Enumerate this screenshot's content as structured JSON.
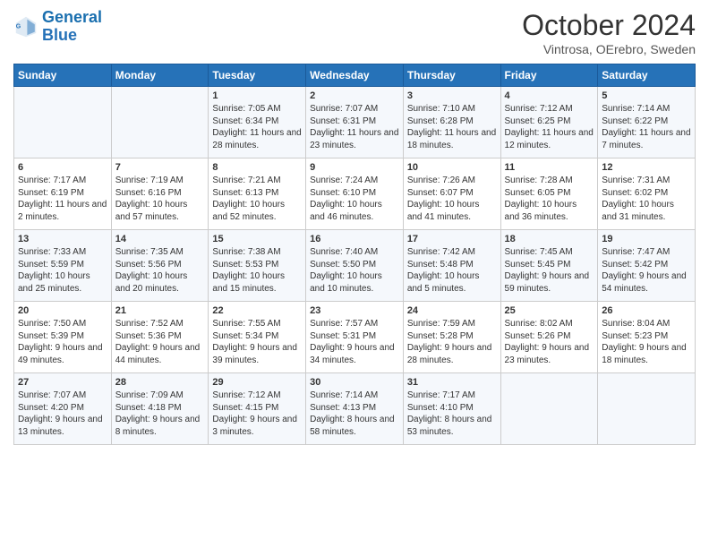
{
  "header": {
    "logo_line1": "General",
    "logo_line2": "Blue",
    "month": "October 2024",
    "location": "Vintrosa, OErebro, Sweden"
  },
  "days_of_week": [
    "Sunday",
    "Monday",
    "Tuesday",
    "Wednesday",
    "Thursday",
    "Friday",
    "Saturday"
  ],
  "weeks": [
    [
      {
        "day": "",
        "content": ""
      },
      {
        "day": "",
        "content": ""
      },
      {
        "day": "1",
        "content": "Sunrise: 7:05 AM\nSunset: 6:34 PM\nDaylight: 11 hours and 28 minutes."
      },
      {
        "day": "2",
        "content": "Sunrise: 7:07 AM\nSunset: 6:31 PM\nDaylight: 11 hours and 23 minutes."
      },
      {
        "day": "3",
        "content": "Sunrise: 7:10 AM\nSunset: 6:28 PM\nDaylight: 11 hours and 18 minutes."
      },
      {
        "day": "4",
        "content": "Sunrise: 7:12 AM\nSunset: 6:25 PM\nDaylight: 11 hours and 12 minutes."
      },
      {
        "day": "5",
        "content": "Sunrise: 7:14 AM\nSunset: 6:22 PM\nDaylight: 11 hours and 7 minutes."
      }
    ],
    [
      {
        "day": "6",
        "content": "Sunrise: 7:17 AM\nSunset: 6:19 PM\nDaylight: 11 hours and 2 minutes."
      },
      {
        "day": "7",
        "content": "Sunrise: 7:19 AM\nSunset: 6:16 PM\nDaylight: 10 hours and 57 minutes."
      },
      {
        "day": "8",
        "content": "Sunrise: 7:21 AM\nSunset: 6:13 PM\nDaylight: 10 hours and 52 minutes."
      },
      {
        "day": "9",
        "content": "Sunrise: 7:24 AM\nSunset: 6:10 PM\nDaylight: 10 hours and 46 minutes."
      },
      {
        "day": "10",
        "content": "Sunrise: 7:26 AM\nSunset: 6:07 PM\nDaylight: 10 hours and 41 minutes."
      },
      {
        "day": "11",
        "content": "Sunrise: 7:28 AM\nSunset: 6:05 PM\nDaylight: 10 hours and 36 minutes."
      },
      {
        "day": "12",
        "content": "Sunrise: 7:31 AM\nSunset: 6:02 PM\nDaylight: 10 hours and 31 minutes."
      }
    ],
    [
      {
        "day": "13",
        "content": "Sunrise: 7:33 AM\nSunset: 5:59 PM\nDaylight: 10 hours and 25 minutes."
      },
      {
        "day": "14",
        "content": "Sunrise: 7:35 AM\nSunset: 5:56 PM\nDaylight: 10 hours and 20 minutes."
      },
      {
        "day": "15",
        "content": "Sunrise: 7:38 AM\nSunset: 5:53 PM\nDaylight: 10 hours and 15 minutes."
      },
      {
        "day": "16",
        "content": "Sunrise: 7:40 AM\nSunset: 5:50 PM\nDaylight: 10 hours and 10 minutes."
      },
      {
        "day": "17",
        "content": "Sunrise: 7:42 AM\nSunset: 5:48 PM\nDaylight: 10 hours and 5 minutes."
      },
      {
        "day": "18",
        "content": "Sunrise: 7:45 AM\nSunset: 5:45 PM\nDaylight: 9 hours and 59 minutes."
      },
      {
        "day": "19",
        "content": "Sunrise: 7:47 AM\nSunset: 5:42 PM\nDaylight: 9 hours and 54 minutes."
      }
    ],
    [
      {
        "day": "20",
        "content": "Sunrise: 7:50 AM\nSunset: 5:39 PM\nDaylight: 9 hours and 49 minutes."
      },
      {
        "day": "21",
        "content": "Sunrise: 7:52 AM\nSunset: 5:36 PM\nDaylight: 9 hours and 44 minutes."
      },
      {
        "day": "22",
        "content": "Sunrise: 7:55 AM\nSunset: 5:34 PM\nDaylight: 9 hours and 39 minutes."
      },
      {
        "day": "23",
        "content": "Sunrise: 7:57 AM\nSunset: 5:31 PM\nDaylight: 9 hours and 34 minutes."
      },
      {
        "day": "24",
        "content": "Sunrise: 7:59 AM\nSunset: 5:28 PM\nDaylight: 9 hours and 28 minutes."
      },
      {
        "day": "25",
        "content": "Sunrise: 8:02 AM\nSunset: 5:26 PM\nDaylight: 9 hours and 23 minutes."
      },
      {
        "day": "26",
        "content": "Sunrise: 8:04 AM\nSunset: 5:23 PM\nDaylight: 9 hours and 18 minutes."
      }
    ],
    [
      {
        "day": "27",
        "content": "Sunrise: 7:07 AM\nSunset: 4:20 PM\nDaylight: 9 hours and 13 minutes."
      },
      {
        "day": "28",
        "content": "Sunrise: 7:09 AM\nSunset: 4:18 PM\nDaylight: 9 hours and 8 minutes."
      },
      {
        "day": "29",
        "content": "Sunrise: 7:12 AM\nSunset: 4:15 PM\nDaylight: 9 hours and 3 minutes."
      },
      {
        "day": "30",
        "content": "Sunrise: 7:14 AM\nSunset: 4:13 PM\nDaylight: 8 hours and 58 minutes."
      },
      {
        "day": "31",
        "content": "Sunrise: 7:17 AM\nSunset: 4:10 PM\nDaylight: 8 hours and 53 minutes."
      },
      {
        "day": "",
        "content": ""
      },
      {
        "day": "",
        "content": ""
      }
    ]
  ]
}
